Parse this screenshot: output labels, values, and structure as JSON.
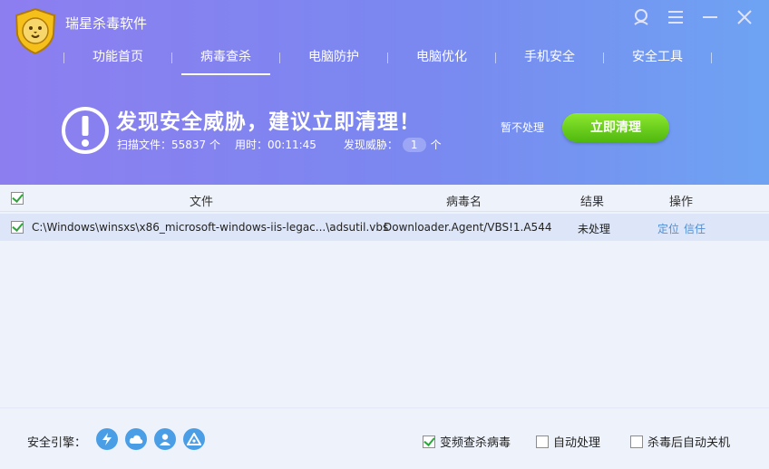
{
  "app": {
    "title": "瑞星杀毒软件"
  },
  "nav": [
    {
      "label": "功能首页"
    },
    {
      "label": "病毒查杀"
    },
    {
      "label": "电脑防护"
    },
    {
      "label": "电脑优化"
    },
    {
      "label": "手机安全"
    },
    {
      "label": "安全工具"
    }
  ],
  "alert": {
    "title": "发现安全威胁，建议立即清理！",
    "scanned_label": "扫描文件：55837 个",
    "time_label": "用时：00:11:45",
    "threats_label": "发现威胁：",
    "threats_count": "1",
    "threats_unit": "个",
    "ignore_label": "暂不处理",
    "clean_label": "立即清理"
  },
  "table": {
    "columns": {
      "file": "文件",
      "virus": "病毒名",
      "result": "结果",
      "action": "操作"
    },
    "rows": [
      {
        "file": "C:\\Windows\\winsxs\\x86_microsoft-windows-iis-legac...\\adsutil.vbs",
        "virus": "Downloader.Agent/VBS!1.A544",
        "result": "未处理",
        "locate": "定位",
        "trust": "信任"
      }
    ]
  },
  "footer": {
    "engine_label": "安全引擎：",
    "engine_icons": [
      "lightning-icon",
      "cloud-icon",
      "user-icon",
      "triangle-icon"
    ],
    "options": [
      {
        "label": "变频查杀病毒",
        "checked": true
      },
      {
        "label": "自动处理",
        "checked": false
      },
      {
        "label": "杀毒后自动关机",
        "checked": false
      }
    ]
  },
  "colors": {
    "accent_green": "#4fb80e",
    "header_start": "#8d7ef0",
    "header_end": "#6ea3f2",
    "link": "#4f8fd8"
  }
}
